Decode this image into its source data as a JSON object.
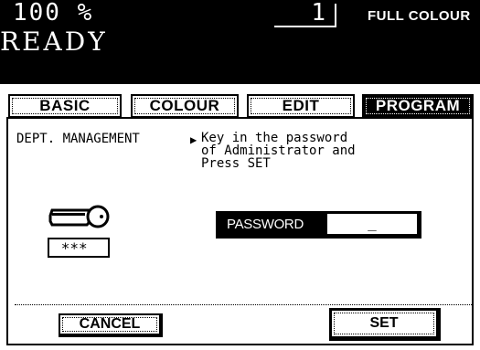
{
  "status": {
    "zoom": "100  %",
    "copies": "1",
    "colour_mode": "FULL COLOUR",
    "ready": "READY"
  },
  "tabs": [
    {
      "label": "BASIC",
      "active": false
    },
    {
      "label": "COLOUR",
      "active": false
    },
    {
      "label": "EDIT",
      "active": false
    },
    {
      "label": "PROGRAM",
      "active": true
    }
  ],
  "panel": {
    "title": "DEPT. MANAGEMENT",
    "pointer": "▶",
    "instruction": "Key in the password\nof Administrator and\nPress SET",
    "masked_icon_text": "***_",
    "password_label": "PASSWORD",
    "password_value": "_"
  },
  "buttons": {
    "cancel": "CANCEL",
    "set": "SET"
  },
  "icons": {
    "key": "key-icon"
  }
}
